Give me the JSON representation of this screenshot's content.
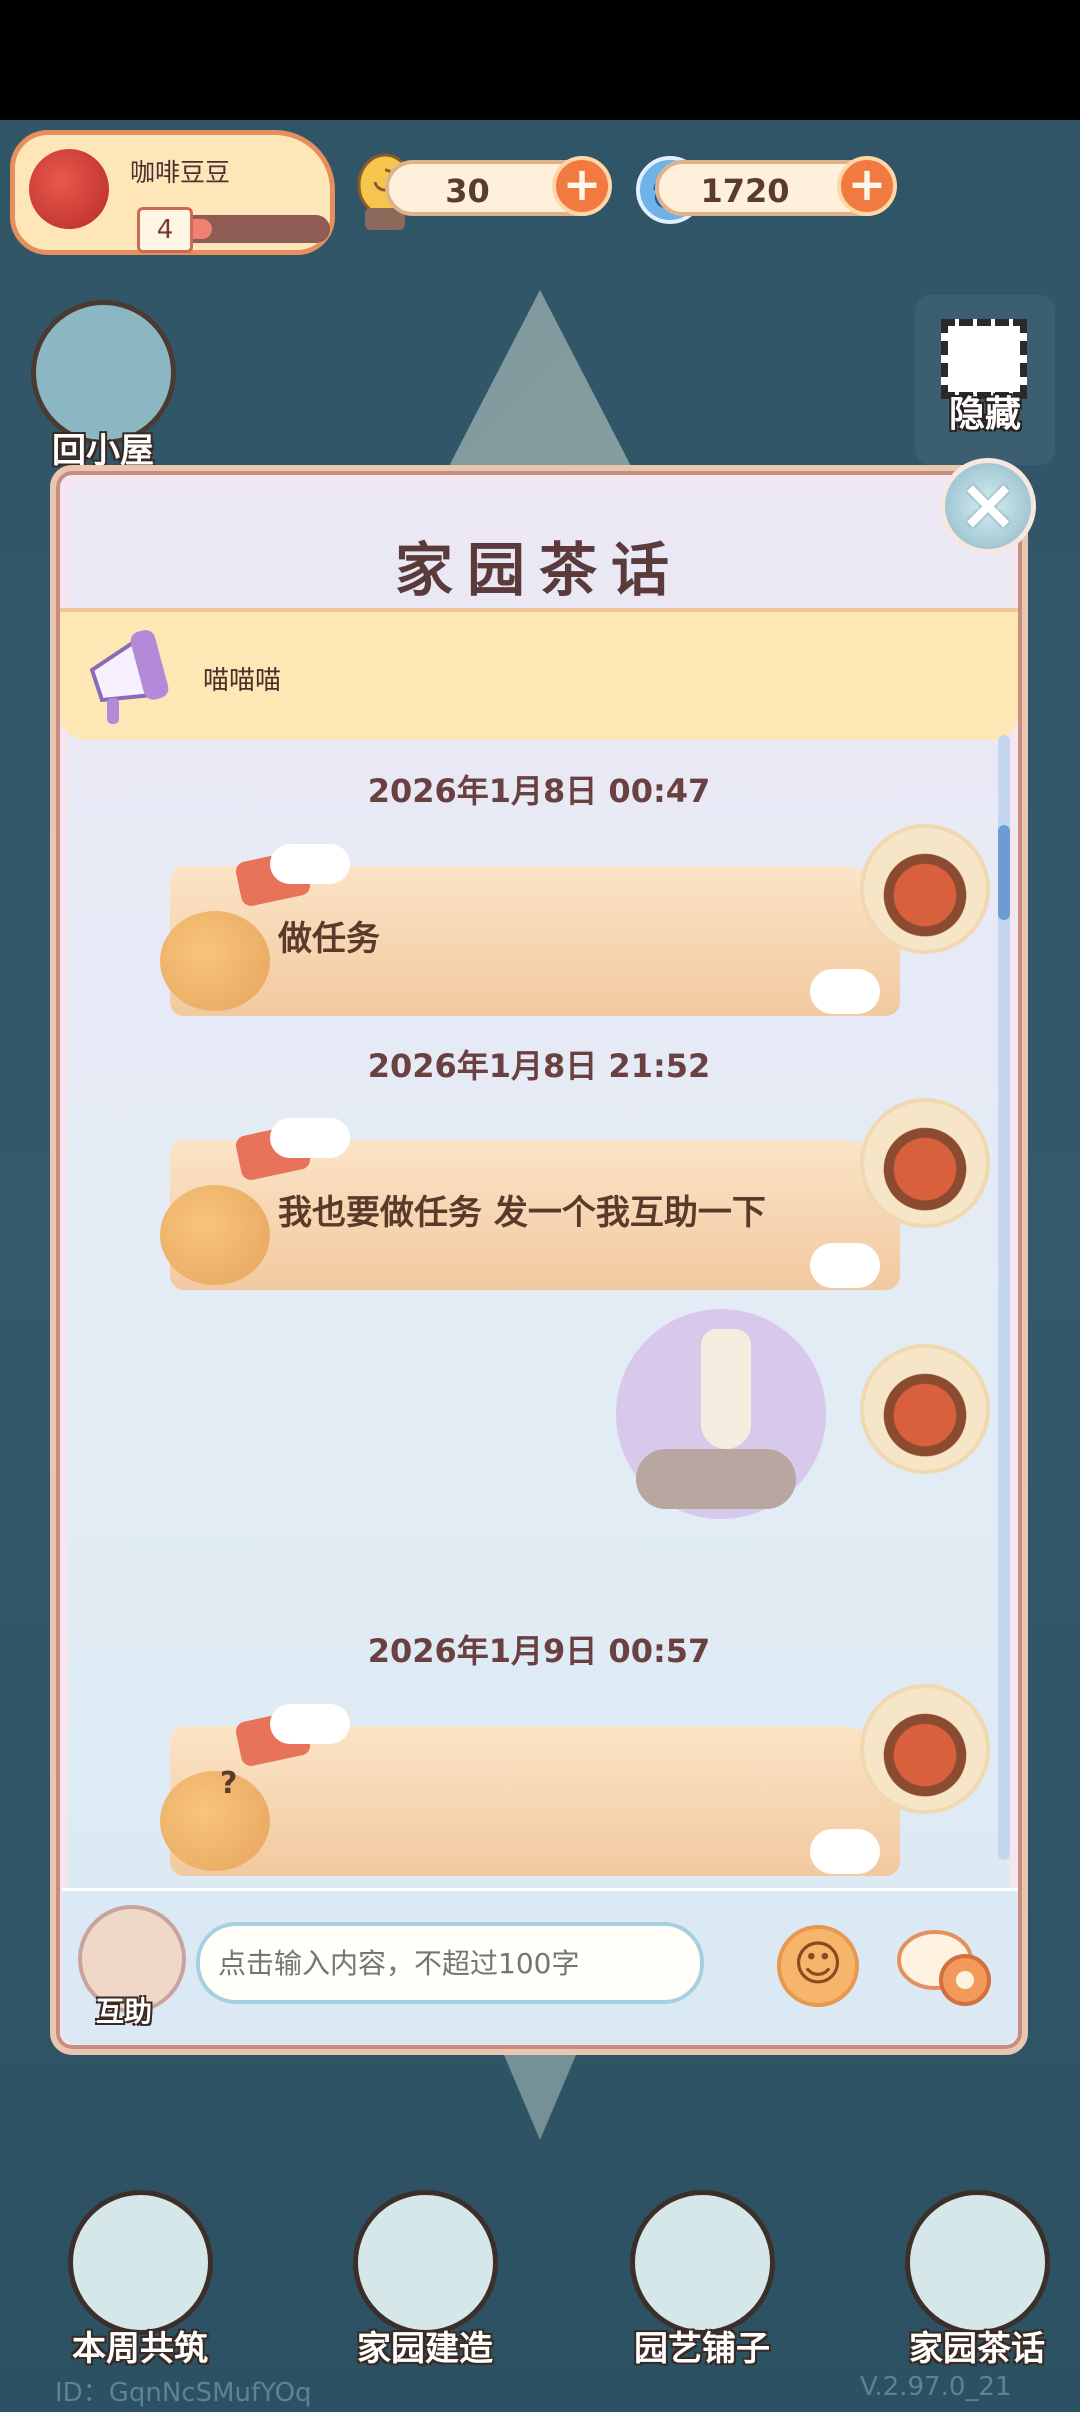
{
  "hud": {
    "player_name": "咖啡豆豆",
    "level": "4",
    "level_progress": 0.2,
    "currency1": "30",
    "currency2": "1720",
    "plus": "+"
  },
  "side": {
    "home": "回小屋",
    "hide": "隐藏"
  },
  "dialog": {
    "title": "家园茶话",
    "close": "×",
    "announcement": "喵喵喵",
    "messages": [
      {
        "time": "2026年1月8日 00:47",
        "text": "做任务"
      },
      {
        "time": "2026年1月8日 21:52",
        "text": "我也要做任务 发一个我互助一下"
      },
      {
        "time": "",
        "text": ""
      },
      {
        "time": "2026年1月9日 00:57",
        "text": "?"
      }
    ],
    "help_label": "互助",
    "input_placeholder": "点击输入内容，不超过100字",
    "emoji": "☺"
  },
  "nav": {
    "items": [
      "本周共筑",
      "家园建造",
      "园艺铺子",
      "家园茶话"
    ]
  },
  "footer": {
    "id": "ID：GqnNcSMufYOq",
    "version": "V.2.97.0_21"
  },
  "colors": {
    "accent": "#f07a40",
    "title": "#5a3a3a",
    "bubble": "#f2c9a0"
  },
  "icons": [
    "rose-icon",
    "snail-icon",
    "swirl-icon",
    "plus-icon",
    "house-icon",
    "scan-frame-icon",
    "close-icon",
    "megaphone-icon",
    "red-panda-avatar-icon",
    "handshake-icon",
    "smile-icon",
    "chat-settings-icon"
  ]
}
